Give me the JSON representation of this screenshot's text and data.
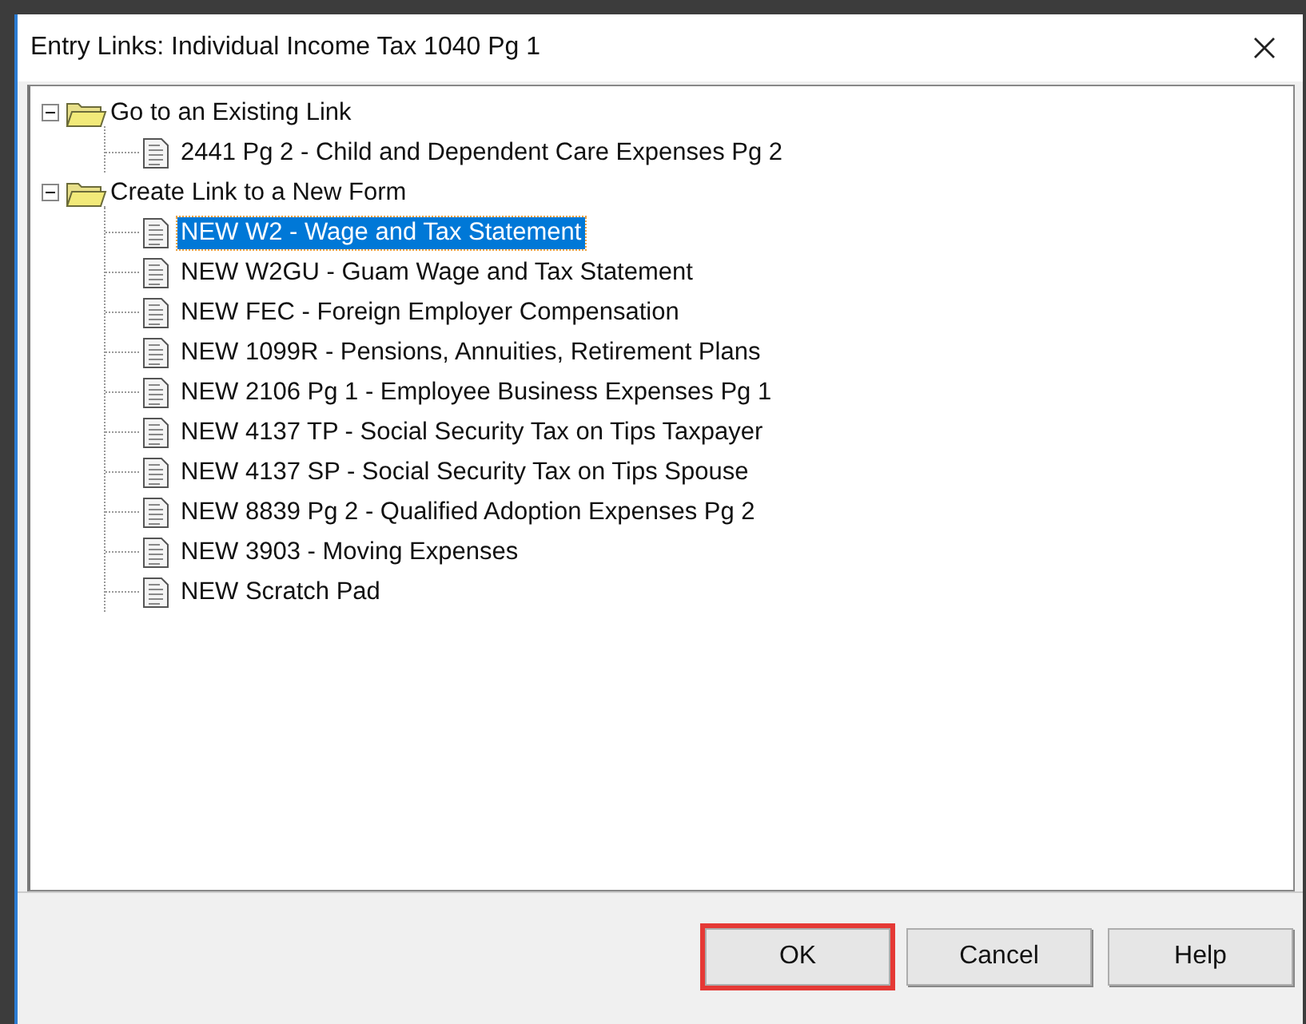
{
  "window": {
    "title": "Entry Links: Individual Income Tax 1040 Pg 1"
  },
  "tree": [
    {
      "label": "Go to an Existing Link",
      "expanded": true,
      "children": [
        {
          "label": "2441 Pg 2 - Child and Dependent Care Expenses Pg 2",
          "selected": false
        }
      ]
    },
    {
      "label": "Create Link to a New Form",
      "expanded": true,
      "children": [
        {
          "label": "NEW W2 - Wage and Tax Statement",
          "selected": true
        },
        {
          "label": "NEW W2GU - Guam Wage and Tax Statement",
          "selected": false
        },
        {
          "label": "NEW FEC - Foreign Employer Compensation",
          "selected": false
        },
        {
          "label": "NEW 1099R - Pensions, Annuities, Retirement Plans",
          "selected": false
        },
        {
          "label": "NEW 2106  Pg 1 - Employee Business Expenses Pg 1",
          "selected": false
        },
        {
          "label": "NEW 4137 TP - Social Security Tax on Tips Taxpayer",
          "selected": false
        },
        {
          "label": "NEW 4137 SP - Social Security Tax on Tips Spouse",
          "selected": false
        },
        {
          "label": "NEW 8839 Pg 2 - Qualified Adoption Expenses Pg 2",
          "selected": false
        },
        {
          "label": "NEW 3903 - Moving Expenses",
          "selected": false
        },
        {
          "label": "NEW Scratch Pad",
          "selected": false
        }
      ]
    }
  ],
  "buttons": [
    {
      "label": "OK",
      "highlighted": true
    },
    {
      "label": "Cancel",
      "highlighted": false
    },
    {
      "label": "Help",
      "highlighted": false
    }
  ]
}
